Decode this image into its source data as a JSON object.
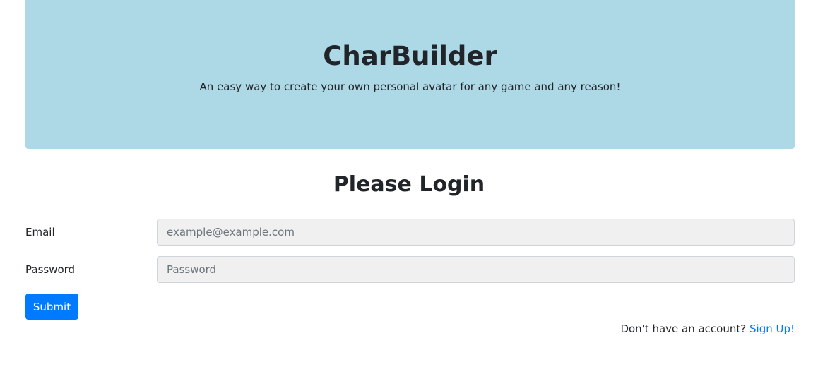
{
  "hero": {
    "title": "CharBuilder",
    "subtitle": "An easy way to create your own personal avatar for any game and any reason!",
    "background_color": "#add8e6"
  },
  "login": {
    "heading": "Please Login",
    "email": {
      "label": "Email",
      "placeholder": "example@example.com",
      "value": ""
    },
    "password": {
      "label": "Password",
      "placeholder": "Password",
      "value": ""
    },
    "submit_label": "Submit",
    "signup_prompt": "Don't have an account?",
    "signup_link": "Sign Up!"
  },
  "colors": {
    "accent": "#007bff",
    "input_background": "#f0f0f0"
  }
}
